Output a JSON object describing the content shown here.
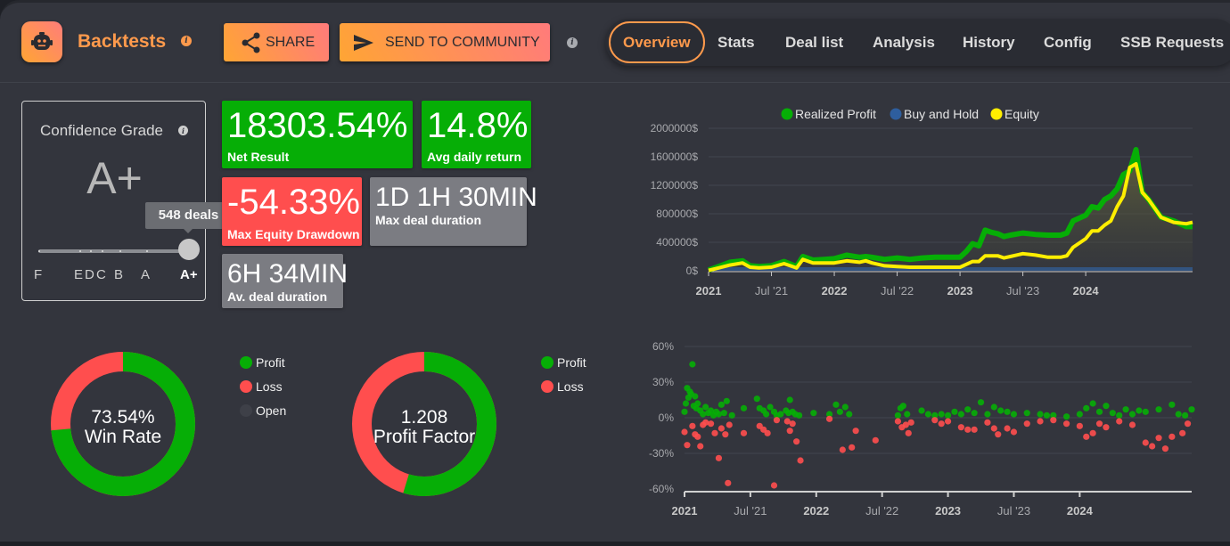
{
  "header": {
    "title": "Backtests",
    "share_label": "SHARE",
    "send_label": "SEND TO COMMUNITY",
    "tabs": [
      {
        "label": "Overview",
        "active": true
      },
      {
        "label": "Stats"
      },
      {
        "label": "Deal list"
      },
      {
        "label": "Analysis"
      },
      {
        "label": "History"
      },
      {
        "label": "Config"
      },
      {
        "label": "SSB Requests"
      }
    ]
  },
  "colors": {
    "accent": "#ff9a4c",
    "profit": "#06ae06",
    "loss": "#ff4e4e",
    "neutral": "#7b7c82",
    "equity": "#ffee00",
    "buy_and_hold": "#2e5e9e"
  },
  "grade": {
    "title": "Confidence Grade",
    "value": "A+",
    "tooltip": "548 deals",
    "scale": [
      "F",
      "E",
      "D",
      "C",
      "B",
      "A",
      "A+"
    ],
    "selected": "A+"
  },
  "stats": {
    "net_result": {
      "value": "18303.54%",
      "label": "Net Result"
    },
    "avg_daily_return": {
      "value": "14.8%",
      "label": "Avg daily return"
    },
    "max_drawdown": {
      "value": "-54.33%",
      "label": "Max Equity Drawdown"
    },
    "max_deal_duration": {
      "value": "1D 1H 30MIN",
      "label": "Max deal duration"
    },
    "avg_deal_duration": {
      "value": "6H 34MIN",
      "label": "Av. deal duration"
    }
  },
  "win_rate": {
    "value": "73.54%",
    "label": "Win Rate",
    "legend": [
      "Profit",
      "Loss",
      "Open"
    ],
    "profit_pct": 73.54,
    "loss_pct": 26.46,
    "open_pct": 0
  },
  "profit_factor": {
    "value": "1.208",
    "label": "Profit Factor",
    "legend": [
      "Profit",
      "Loss"
    ],
    "profit_share": 54.7,
    "loss_share": 45.3
  },
  "chart_data": [
    {
      "type": "line",
      "title": "",
      "legend": [
        "Realized Profit",
        "Buy and Hold",
        "Equity"
      ],
      "legend_position": "top-center",
      "yticks": [
        "2000000$",
        "1600000$",
        "1200000$",
        "800000$",
        "400000$",
        "0$"
      ],
      "xticks": [
        "2021",
        "Jul '21",
        "2022",
        "Jul '22",
        "2023",
        "Jul '23",
        "2024"
      ],
      "ylim": [
        0,
        2000000
      ],
      "xlim": [
        2021.0,
        2024.85
      ],
      "grid": true,
      "series": [
        {
          "name": "Realized Profit",
          "color": "#06ae06",
          "x": [
            2021.0,
            2021.08,
            2021.17,
            2021.27,
            2021.33,
            2021.4,
            2021.5,
            2021.6,
            2021.7,
            2021.75,
            2021.83,
            2021.92,
            2022.0,
            2022.1,
            2022.2,
            2022.25,
            2022.3,
            2022.4,
            2022.5,
            2022.6,
            2022.7,
            2022.8,
            2022.9,
            2023.0,
            2023.05,
            2023.1,
            2023.15,
            2023.2,
            2023.25,
            2023.3,
            2023.35,
            2023.4,
            2023.5,
            2023.6,
            2023.7,
            2023.8,
            2023.85,
            2023.9,
            2024.0,
            2024.05,
            2024.1,
            2024.15,
            2024.2,
            2024.25,
            2024.3,
            2024.35,
            2024.4,
            2024.45,
            2024.5,
            2024.6,
            2024.7,
            2024.8,
            2024.85
          ],
          "y": [
            10000,
            60000,
            120000,
            140000,
            70000,
            60000,
            70000,
            130000,
            60000,
            200000,
            150000,
            160000,
            170000,
            220000,
            190000,
            200000,
            190000,
            160000,
            180000,
            160000,
            180000,
            190000,
            190000,
            190000,
            270000,
            380000,
            350000,
            570000,
            540000,
            520000,
            480000,
            500000,
            530000,
            510000,
            500000,
            500000,
            530000,
            700000,
            780000,
            900000,
            880000,
            1000000,
            1050000,
            1150000,
            1350000,
            1400000,
            1700000,
            1100000,
            1000000,
            750000,
            700000,
            620000,
            620000
          ]
        },
        {
          "name": "Buy and Hold",
          "color": "#2e5e9e",
          "x": [
            2021.0,
            2024.85
          ],
          "y": [
            0,
            0
          ]
        },
        {
          "name": "Equity",
          "color": "#ffee00",
          "x": [
            2021.0,
            2021.08,
            2021.17,
            2021.27,
            2021.33,
            2021.4,
            2021.5,
            2021.6,
            2021.7,
            2021.75,
            2021.83,
            2021.92,
            2022.0,
            2022.1,
            2022.2,
            2022.25,
            2022.3,
            2022.4,
            2022.5,
            2022.6,
            2022.7,
            2022.8,
            2022.9,
            2023.0,
            2023.05,
            2023.1,
            2023.15,
            2023.2,
            2023.25,
            2023.3,
            2023.35,
            2023.4,
            2023.5,
            2023.6,
            2023.7,
            2023.8,
            2023.85,
            2023.9,
            2024.0,
            2024.05,
            2024.1,
            2024.15,
            2024.2,
            2024.25,
            2024.3,
            2024.35,
            2024.4,
            2024.45,
            2024.5,
            2024.6,
            2024.7,
            2024.8,
            2024.85
          ],
          "y": [
            5000,
            40000,
            80000,
            110000,
            50000,
            40000,
            50000,
            100000,
            40000,
            160000,
            110000,
            110000,
            110000,
            140000,
            120000,
            140000,
            110000,
            70000,
            60000,
            50000,
            50000,
            50000,
            50000,
            50000,
            90000,
            130000,
            130000,
            210000,
            210000,
            210000,
            180000,
            200000,
            240000,
            220000,
            190000,
            190000,
            210000,
            330000,
            450000,
            560000,
            560000,
            640000,
            700000,
            900000,
            1050000,
            1450000,
            1500000,
            1100000,
            1000000,
            750000,
            680000,
            660000,
            680000
          ]
        }
      ]
    },
    {
      "type": "scatter",
      "title": "",
      "yticks": [
        "60%",
        "30%",
        "0%",
        "-30%",
        "-60%"
      ],
      "xticks": [
        "2021",
        "Jul '21",
        "2022",
        "Jul '22",
        "2023",
        "Jul '23",
        "2024"
      ],
      "ylim": [
        -60,
        60
      ],
      "xlim": [
        2021.0,
        2024.85
      ],
      "grid": true,
      "series": [
        {
          "name": "Profit",
          "color": "#06ae06",
          "points": [
            [
              2021.0,
              5
            ],
            [
              2021.01,
              12
            ],
            [
              2021.02,
              25
            ],
            [
              2021.03,
              17
            ],
            [
              2021.04,
              22
            ],
            [
              2021.05,
              20
            ],
            [
              2021.06,
              45
            ],
            [
              2021.07,
              10
            ],
            [
              2021.08,
              18
            ],
            [
              2021.09,
              8
            ],
            [
              2021.1,
              12
            ],
            [
              2021.12,
              6
            ],
            [
              2021.14,
              3
            ],
            [
              2021.16,
              9
            ],
            [
              2021.18,
              4
            ],
            [
              2021.2,
              6
            ],
            [
              2021.22,
              2
            ],
            [
              2021.24,
              5
            ],
            [
              2021.26,
              3
            ],
            [
              2021.28,
              11
            ],
            [
              2021.3,
              4
            ],
            [
              2021.32,
              14
            ],
            [
              2021.36,
              2
            ],
            [
              2021.45,
              8
            ],
            [
              2021.55,
              16
            ],
            [
              2021.57,
              8
            ],
            [
              2021.6,
              6
            ],
            [
              2021.62,
              3
            ],
            [
              2021.65,
              9
            ],
            [
              2021.68,
              5
            ],
            [
              2021.7,
              2
            ],
            [
              2021.73,
              3
            ],
            [
              2021.77,
              6
            ],
            [
              2021.79,
              4
            ],
            [
              2021.8,
              15
            ],
            [
              2021.82,
              5
            ],
            [
              2021.84,
              3
            ],
            [
              2021.87,
              2
            ],
            [
              2021.98,
              4
            ],
            [
              2022.1,
              3
            ],
            [
              2022.15,
              11
            ],
            [
              2022.18,
              5
            ],
            [
              2022.22,
              9
            ],
            [
              2022.25,
              3
            ],
            [
              2022.62,
              2
            ],
            [
              2022.64,
              8
            ],
            [
              2022.66,
              10
            ],
            [
              2022.69,
              3
            ],
            [
              2022.8,
              6
            ],
            [
              2022.85,
              3
            ],
            [
              2022.9,
              2
            ],
            [
              2022.95,
              3
            ],
            [
              2023.0,
              2
            ],
            [
              2023.05,
              5
            ],
            [
              2023.1,
              3
            ],
            [
              2023.15,
              7
            ],
            [
              2023.2,
              4
            ],
            [
              2023.25,
              13
            ],
            [
              2023.3,
              3
            ],
            [
              2023.35,
              9
            ],
            [
              2023.4,
              6
            ],
            [
              2023.45,
              5
            ],
            [
              2023.5,
              3
            ],
            [
              2023.6,
              4
            ],
            [
              2023.7,
              3
            ],
            [
              2023.75,
              2
            ],
            [
              2023.8,
              2
            ],
            [
              2023.9,
              1
            ],
            [
              2024.0,
              3
            ],
            [
              2024.05,
              8
            ],
            [
              2024.1,
              12
            ],
            [
              2024.15,
              5
            ],
            [
              2024.2,
              10
            ],
            [
              2024.25,
              4
            ],
            [
              2024.3,
              2
            ],
            [
              2024.35,
              7
            ],
            [
              2024.4,
              3
            ],
            [
              2024.45,
              6
            ],
            [
              2024.5,
              5
            ],
            [
              2024.6,
              7
            ],
            [
              2024.7,
              11
            ],
            [
              2024.75,
              3
            ],
            [
              2024.8,
              2
            ],
            [
              2024.85,
              7
            ]
          ]
        },
        {
          "name": "Loss",
          "color": "#ff4e4e",
          "points": [
            [
              2021.0,
              -12
            ],
            [
              2021.02,
              -23
            ],
            [
              2021.06,
              -7
            ],
            [
              2021.08,
              -14
            ],
            [
              2021.1,
              -16
            ],
            [
              2021.12,
              -24
            ],
            [
              2021.14,
              -6
            ],
            [
              2021.16,
              -4
            ],
            [
              2021.2,
              -5
            ],
            [
              2021.23,
              -13
            ],
            [
              2021.26,
              -34
            ],
            [
              2021.28,
              -9
            ],
            [
              2021.31,
              -14
            ],
            [
              2021.33,
              -55
            ],
            [
              2021.34,
              -6
            ],
            [
              2021.45,
              -13
            ],
            [
              2021.57,
              -7
            ],
            [
              2021.6,
              -10
            ],
            [
              2021.63,
              -13
            ],
            [
              2021.68,
              -57
            ],
            [
              2021.7,
              -2
            ],
            [
              2021.78,
              -3
            ],
            [
              2021.8,
              -11
            ],
            [
              2021.82,
              -5
            ],
            [
              2021.85,
              -20
            ],
            [
              2021.88,
              -36
            ],
            [
              2022.1,
              -1
            ],
            [
              2022.2,
              -27
            ],
            [
              2022.27,
              -25
            ],
            [
              2022.3,
              -11
            ],
            [
              2022.45,
              -19
            ],
            [
              2022.62,
              -3
            ],
            [
              2022.65,
              -8
            ],
            [
              2022.68,
              -6
            ],
            [
              2022.7,
              -13
            ],
            [
              2022.72,
              -4
            ],
            [
              2022.9,
              -2
            ],
            [
              2022.95,
              -5
            ],
            [
              2023.0,
              -3
            ],
            [
              2023.1,
              -8
            ],
            [
              2023.15,
              -10
            ],
            [
              2023.2,
              -10
            ],
            [
              2023.3,
              -4
            ],
            [
              2023.35,
              -9
            ],
            [
              2023.38,
              -14
            ],
            [
              2023.45,
              -9
            ],
            [
              2023.5,
              -12
            ],
            [
              2023.6,
              -5
            ],
            [
              2023.7,
              -3
            ],
            [
              2023.8,
              -2
            ],
            [
              2023.9,
              -5
            ],
            [
              2024.0,
              -7
            ],
            [
              2024.05,
              -16
            ],
            [
              2024.1,
              -13
            ],
            [
              2024.15,
              -5
            ],
            [
              2024.2,
              -8
            ],
            [
              2024.3,
              -3
            ],
            [
              2024.4,
              -6
            ],
            [
              2024.5,
              -21
            ],
            [
              2024.55,
              -24
            ],
            [
              2024.6,
              -17
            ],
            [
              2024.65,
              -26
            ],
            [
              2024.7,
              -16
            ],
            [
              2024.78,
              -13
            ],
            [
              2024.82,
              -5
            ]
          ]
        }
      ]
    }
  ]
}
